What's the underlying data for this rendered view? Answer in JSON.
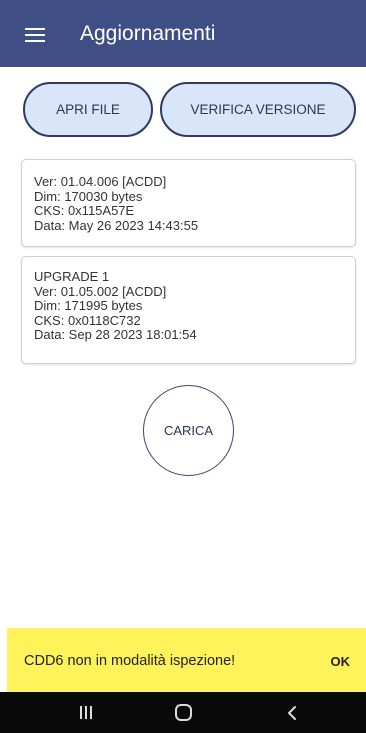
{
  "appbar": {
    "title": "Aggiornamenti",
    "menu_icon": "hamburger-menu-icon",
    "background": "#3f4f86"
  },
  "actions": {
    "open_file_label": "APRI FILE",
    "verify_version_label": "VERIFICA VERSIONE",
    "button_fill": "#d9e6fa"
  },
  "current_firmware": {
    "lines": [
      "Ver: 01.04.006 [ACDD]",
      "Dim: 170030 bytes",
      "CKS: 0x115A57E",
      "Data: May 26 2023 14:43:55"
    ]
  },
  "upgrade_firmware": {
    "lines": [
      "UPGRADE 1",
      "Ver: 01.05.002 [ACDD]",
      "Dim: 171995 bytes",
      "CKS: 0x0118C732",
      "Data: Sep 28 2023 18:01:54"
    ]
  },
  "load_button": {
    "label": "CARICA"
  },
  "snackbar": {
    "message": "CDD6 non in modalità ispezione!",
    "action": "OK",
    "background": "#fff25a"
  },
  "system_nav": {
    "recents_icon": "recents-icon",
    "home_icon": "home-icon",
    "back_icon": "back-icon"
  }
}
